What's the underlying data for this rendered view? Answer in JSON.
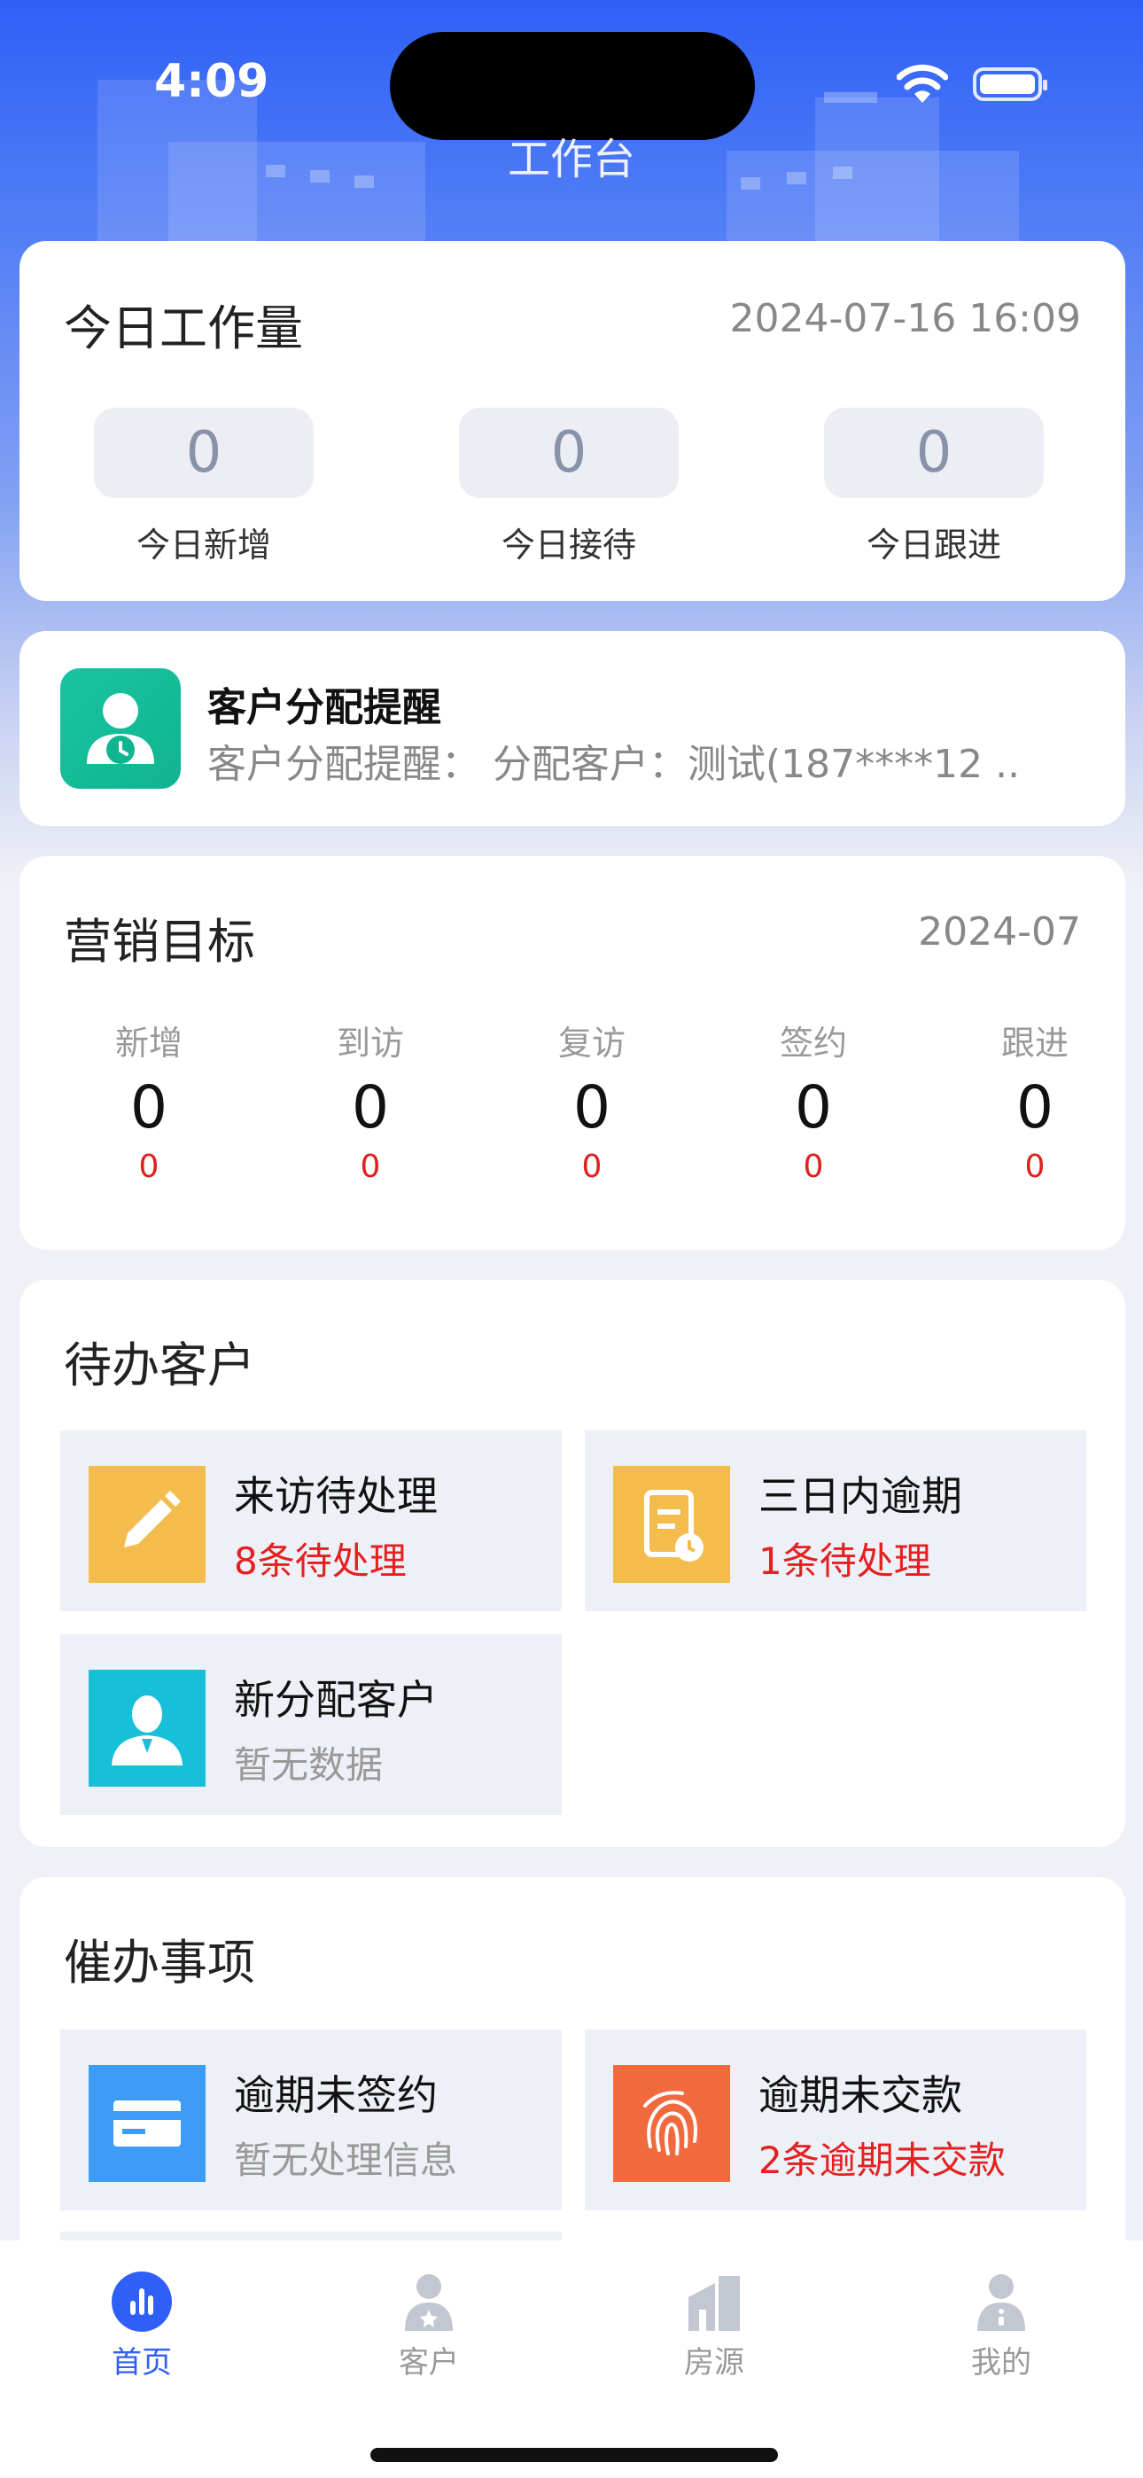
{
  "status_bar": {
    "time": "4:09"
  },
  "header": {
    "title": "工作台"
  },
  "today_workload": {
    "title": "今日工作量",
    "datetime": "2024-07-16 16:09",
    "stats": [
      {
        "label": "今日新增",
        "value": "0"
      },
      {
        "label": "今日接待",
        "value": "0"
      },
      {
        "label": "今日跟进",
        "value": "0"
      }
    ]
  },
  "notice": {
    "title": "客户分配提醒",
    "body": "客户分配提醒：  分配客户：测试(187****12  ..",
    "icon": "customer-clock-icon"
  },
  "marketing_goal": {
    "title": "营销目标",
    "month": "2024-07",
    "columns": [
      {
        "label": "新增",
        "value": "0",
        "target": "0"
      },
      {
        "label": "到访",
        "value": "0",
        "target": "0"
      },
      {
        "label": "复访",
        "value": "0",
        "target": "0"
      },
      {
        "label": "签约",
        "value": "0",
        "target": "0"
      },
      {
        "label": "跟进",
        "value": "0",
        "target": "0"
      }
    ]
  },
  "pending_customers": {
    "title": "待办客户",
    "items": [
      {
        "title": "来访待处理",
        "sub": "8条待处理",
        "icon": "pencil-icon",
        "color": "#f4bc4c"
      },
      {
        "title": "三日内逾期",
        "sub": "1条待处理",
        "icon": "checklist-clock-icon",
        "color": "#f4bc4c"
      },
      {
        "title": "新分配客户",
        "sub": "暂无数据",
        "icon": "person-icon",
        "color": "#17c0d8"
      }
    ]
  },
  "urge_items": {
    "title": "催办事项",
    "items": [
      {
        "title": "逾期未签约",
        "sub": "暂无处理信息",
        "icon": "card-icon",
        "color": "#3c9cf6"
      },
      {
        "title": "逾期未交款",
        "sub": "2条逾期未交款",
        "icon": "fingerprint-icon",
        "color": "#f06a3e"
      }
    ]
  },
  "tabbar": {
    "items": [
      {
        "label": "首页",
        "icon": "bar-chart-icon",
        "active": true
      },
      {
        "label": "客户",
        "icon": "customer-icon",
        "active": false
      },
      {
        "label": "房源",
        "icon": "building-icon",
        "active": false
      },
      {
        "label": "我的",
        "icon": "profile-icon",
        "active": false
      }
    ]
  },
  "colors": {
    "brand": "#2f5ff6",
    "alert": "#e42020",
    "notice_icon": "#19c4a3"
  }
}
